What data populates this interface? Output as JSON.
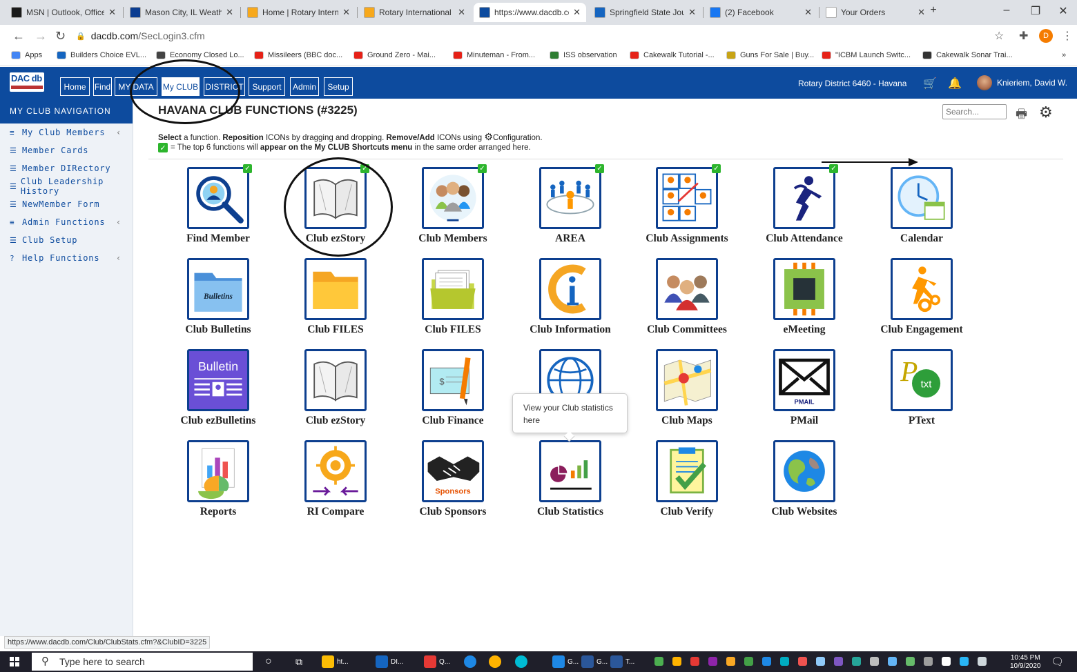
{
  "browser": {
    "tabs": [
      {
        "title": "MSN | Outlook, Office",
        "color": "#1a1a1a"
      },
      {
        "title": "Mason City, IL Weathe",
        "color": "#0b3d91"
      },
      {
        "title": "Home | Rotary Interna",
        "color": "#f7a81b"
      },
      {
        "title": "Rotary International D",
        "color": "#f7a81b"
      },
      {
        "title": "https://www.dacdb.co",
        "color": "#0d4b9e"
      },
      {
        "title": "Springfield State Jour",
        "color": "#1565c0"
      },
      {
        "title": "(2) Facebook",
        "color": "#1877f2"
      },
      {
        "title": "Your Orders",
        "color": "#ffffff"
      }
    ],
    "new_tab": "+",
    "url_host": "dacdb.com",
    "url_path": "/SecLogin3.cfm",
    "profile_initial": "D",
    "bookmarks": [
      {
        "label": "Apps",
        "color": "#4285f4"
      },
      {
        "label": "Builders Choice EVL...",
        "color": "#1565c0"
      },
      {
        "label": "Economy Closed Lo...",
        "color": "#444444"
      },
      {
        "label": "Missileers (BBC doc...",
        "color": "#e62117"
      },
      {
        "label": "Ground Zero - Mai...",
        "color": "#e62117"
      },
      {
        "label": "Minuteman - From...",
        "color": "#e62117"
      },
      {
        "label": "ISS observation",
        "color": "#2e7d32"
      },
      {
        "label": "Cakewalk Tutorial -...",
        "color": "#e62117"
      },
      {
        "label": "Guns For Sale | Buy...",
        "color": "#c8a415"
      },
      {
        "label": "\"ICBM Launch Switc...",
        "color": "#e62117"
      },
      {
        "label": "Cakewalk Sonar Trai...",
        "color": "#333333"
      }
    ],
    "more_bookmarks": "»",
    "status_url": "https://www.dacdb.com/Club/ClubStats.cfm?&ClubID=3225"
  },
  "app": {
    "logo_text": "DAC db",
    "nav_tabs": [
      "Home",
      "Find",
      "MY DATA",
      "My CLUB",
      "DISTRICT",
      "Support",
      "Admin",
      "Setup"
    ],
    "active_tab": "My CLUB",
    "district_label": "Rotary District 6460 - Havana",
    "user_name": "Knieriem, David W."
  },
  "sidebar": {
    "title": "MY CLUB NAVIGATION",
    "items": [
      {
        "label": "My Club Members",
        "icon": "menu-icon",
        "glyph": "≡",
        "expand": true
      },
      {
        "label": "Member Cards",
        "icon": "list-icon",
        "glyph": "☰",
        "expand": false
      },
      {
        "label": "Member DIRectory",
        "icon": "list-icon",
        "glyph": "☰",
        "expand": false
      },
      {
        "label": "Club Leadership History",
        "icon": "list-icon",
        "glyph": "☰",
        "expand": false
      },
      {
        "label": "NewMember Form",
        "icon": "list-icon",
        "glyph": "☰",
        "expand": false
      },
      {
        "label": "Admin Functions",
        "icon": "menu-icon",
        "glyph": "≡",
        "expand": true
      },
      {
        "label": "Club Setup",
        "icon": "list-icon",
        "glyph": "☰",
        "expand": false
      },
      {
        "label": "Help Functions",
        "icon": "help-icon",
        "glyph": "?",
        "expand": true
      }
    ]
  },
  "main": {
    "title": "HAVANA CLUB FUNCTIONS (#3225)",
    "search_placeholder": "Search...",
    "instructions": {
      "select": "Select",
      "a_function": " a function. ",
      "reposition": "Reposition",
      "icons_by": " ICONs by dragging and dropping. ",
      "remove_add": "Remove/Add",
      "icons_using": " ICONs using ",
      "configuration": "Configuration.",
      "line2_a": "= The top 6 functions will ",
      "line2_b": "appear on the My CLUB Shortcuts menu",
      "line2_c": " in the same order arranged here."
    },
    "tooltip": "View your Club statistics here",
    "functions": [
      {
        "label": "Find Member",
        "icon": "find-member-icon",
        "shortcut": true
      },
      {
        "label": "Club ezStory",
        "icon": "book-icon",
        "shortcut": true
      },
      {
        "label": "Club Members",
        "icon": "members-icon",
        "shortcut": true
      },
      {
        "label": "AREA",
        "icon": "area-icon",
        "shortcut": true
      },
      {
        "label": "Club Assignments",
        "icon": "assignments-icon",
        "shortcut": true
      },
      {
        "label": "Club Attendance",
        "icon": "attendance-icon",
        "shortcut": true
      },
      {
        "label": "Calendar",
        "icon": "calendar-icon",
        "shortcut": false
      },
      {
        "label": "Club Bulletins",
        "icon": "bulletins-folder-icon",
        "shortcut": false,
        "tile_text": "Bulletins"
      },
      {
        "label": "Club FILES",
        "icon": "folder-icon",
        "shortcut": false
      },
      {
        "label": "Club FILES",
        "icon": "file-folder-icon",
        "shortcut": false
      },
      {
        "label": "Club Information",
        "icon": "info-icon",
        "shortcut": false
      },
      {
        "label": "Club Committees",
        "icon": "committees-icon",
        "shortcut": false
      },
      {
        "label": "eMeeting",
        "icon": "emeeting-icon",
        "shortcut": false
      },
      {
        "label": "Club Engagement",
        "icon": "engagement-icon",
        "shortcut": false
      },
      {
        "label": "Club ezBulletins",
        "icon": "ezbulletin-icon",
        "shortcut": false,
        "tile_text": "Bulletin"
      },
      {
        "label": "Club ezStory",
        "icon": "book-icon",
        "shortcut": false
      },
      {
        "label": "Club Finance",
        "icon": "finance-icon",
        "shortcut": false
      },
      {
        "label": "",
        "icon": "globe-icon",
        "shortcut": false
      },
      {
        "label": "Club Maps",
        "icon": "map-icon",
        "shortcut": false
      },
      {
        "label": "PMail",
        "icon": "mail-icon",
        "shortcut": false,
        "tile_text": "PMAIL"
      },
      {
        "label": "PText",
        "icon": "text-icon",
        "shortcut": false,
        "tile_text": "txt"
      },
      {
        "label": "Reports",
        "icon": "reports-icon",
        "shortcut": false
      },
      {
        "label": "RI Compare",
        "icon": "rotary-compare-icon",
        "shortcut": false
      },
      {
        "label": "Club Sponsors",
        "icon": "sponsors-icon",
        "shortcut": false,
        "tile_text": "Sponsors"
      },
      {
        "label": "Club Statistics",
        "icon": "statistics-icon",
        "shortcut": false
      },
      {
        "label": "Club Verify",
        "icon": "verify-icon",
        "shortcut": false
      },
      {
        "label": "Club Websites",
        "icon": "websites-globe-icon",
        "shortcut": false
      }
    ]
  },
  "taskbar": {
    "search_placeholder": "Type here to search",
    "apps": [
      "ht...",
      "DI...",
      "Q...",
      "G...",
      "G...",
      "T..."
    ],
    "time": "10:45 PM",
    "date": "10/9/2020"
  }
}
